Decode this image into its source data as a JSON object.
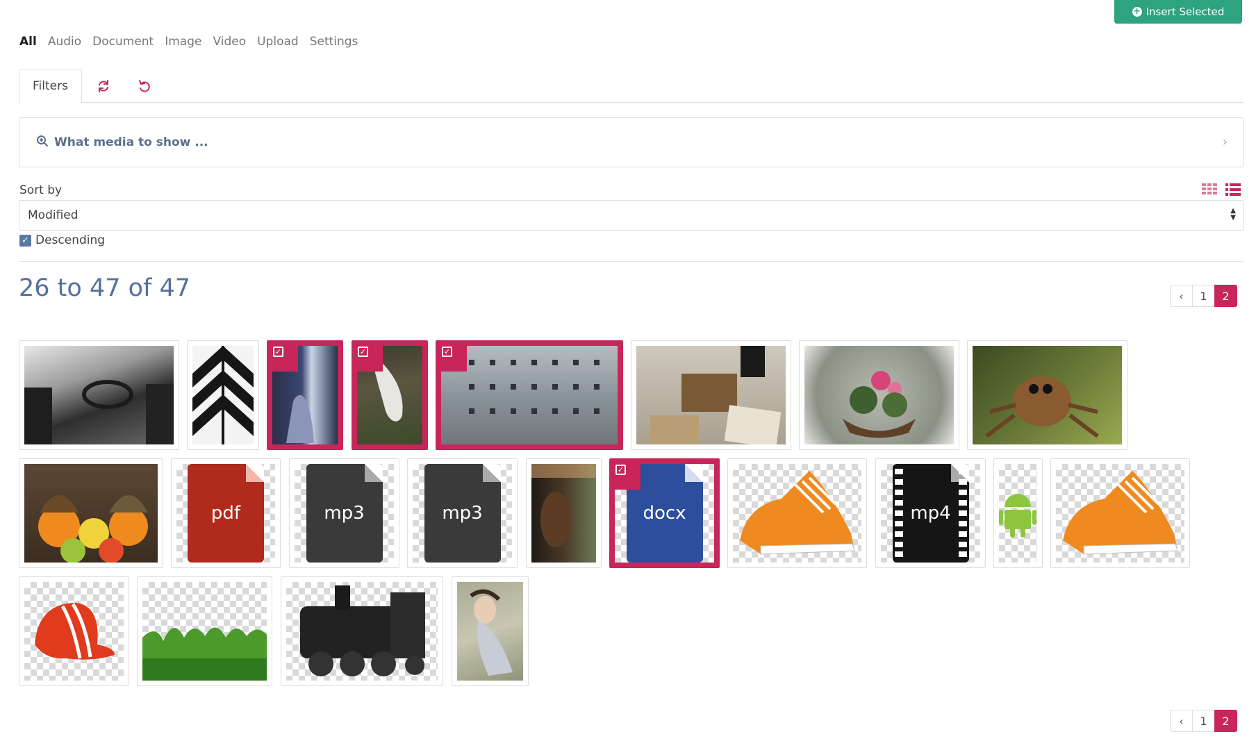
{
  "header": {
    "insert_label": "Insert Selected"
  },
  "tabs": [
    {
      "label": "All"
    },
    {
      "label": "Audio"
    },
    {
      "label": "Document"
    },
    {
      "label": "Image"
    },
    {
      "label": "Video"
    },
    {
      "label": "Upload"
    },
    {
      "label": "Settings"
    }
  ],
  "active_tab": "All",
  "toolbar": {
    "filters_label": "Filters"
  },
  "filter": {
    "placeholder": "What media to show ..."
  },
  "sort": {
    "label": "Sort by",
    "value": "Modified",
    "descending_label": "Descending",
    "descending_checked": true
  },
  "results": {
    "count_text": "26 to 47 of 47"
  },
  "pagination": {
    "prev": "‹",
    "pages": [
      "1",
      "2"
    ],
    "current": "2"
  },
  "media": [
    {
      "kind": "photo",
      "subject": "black-and-white car interior",
      "selected": false
    },
    {
      "kind": "photo",
      "subject": "black-and-white building facade",
      "selected": false
    },
    {
      "kind": "photo",
      "subject": "woman at window",
      "selected": true
    },
    {
      "kind": "photo",
      "subject": "white horse grazing",
      "selected": true
    },
    {
      "kind": "photo",
      "subject": "weathered concrete building",
      "selected": true
    },
    {
      "kind": "photo",
      "subject": "letters and ink pot",
      "selected": false
    },
    {
      "kind": "photo",
      "subject": "flower basket in snow",
      "selected": false
    },
    {
      "kind": "photo",
      "subject": "jumping spider",
      "selected": false
    },
    {
      "kind": "photo",
      "subject": "citrus fruits with knitted hats",
      "selected": false
    },
    {
      "kind": "file",
      "ext": "pdf",
      "selected": false
    },
    {
      "kind": "file",
      "ext": "mp3",
      "selected": false
    },
    {
      "kind": "file",
      "ext": "mp3",
      "selected": false
    },
    {
      "kind": "photo",
      "subject": "woman on balcony",
      "selected": false
    },
    {
      "kind": "file",
      "ext": "docx",
      "selected": true
    },
    {
      "kind": "photo",
      "subject": "orange sneakers",
      "selected": false
    },
    {
      "kind": "file",
      "ext": "mp4",
      "selected": false
    },
    {
      "kind": "photo",
      "subject": "android robot",
      "selected": false
    },
    {
      "kind": "photo",
      "subject": "orange sneakers",
      "selected": false
    },
    {
      "kind": "photo",
      "subject": "red cap",
      "selected": false
    },
    {
      "kind": "photo",
      "subject": "green grass",
      "selected": false
    },
    {
      "kind": "photo",
      "subject": "steam locomotive",
      "selected": false
    },
    {
      "kind": "photo",
      "subject": "woman lying on ground",
      "selected": false
    }
  ],
  "colors": {
    "accent": "#c8265a",
    "success": "#2ea37f",
    "muted_blue": "#56709a"
  },
  "icons": [
    "plus-circle-icon",
    "refresh-icon",
    "undo-icon",
    "search-plus-icon",
    "chevron-right-icon",
    "grid-view-icon",
    "list-view-icon",
    "check-square-icon",
    "chevron-left-icon"
  ]
}
